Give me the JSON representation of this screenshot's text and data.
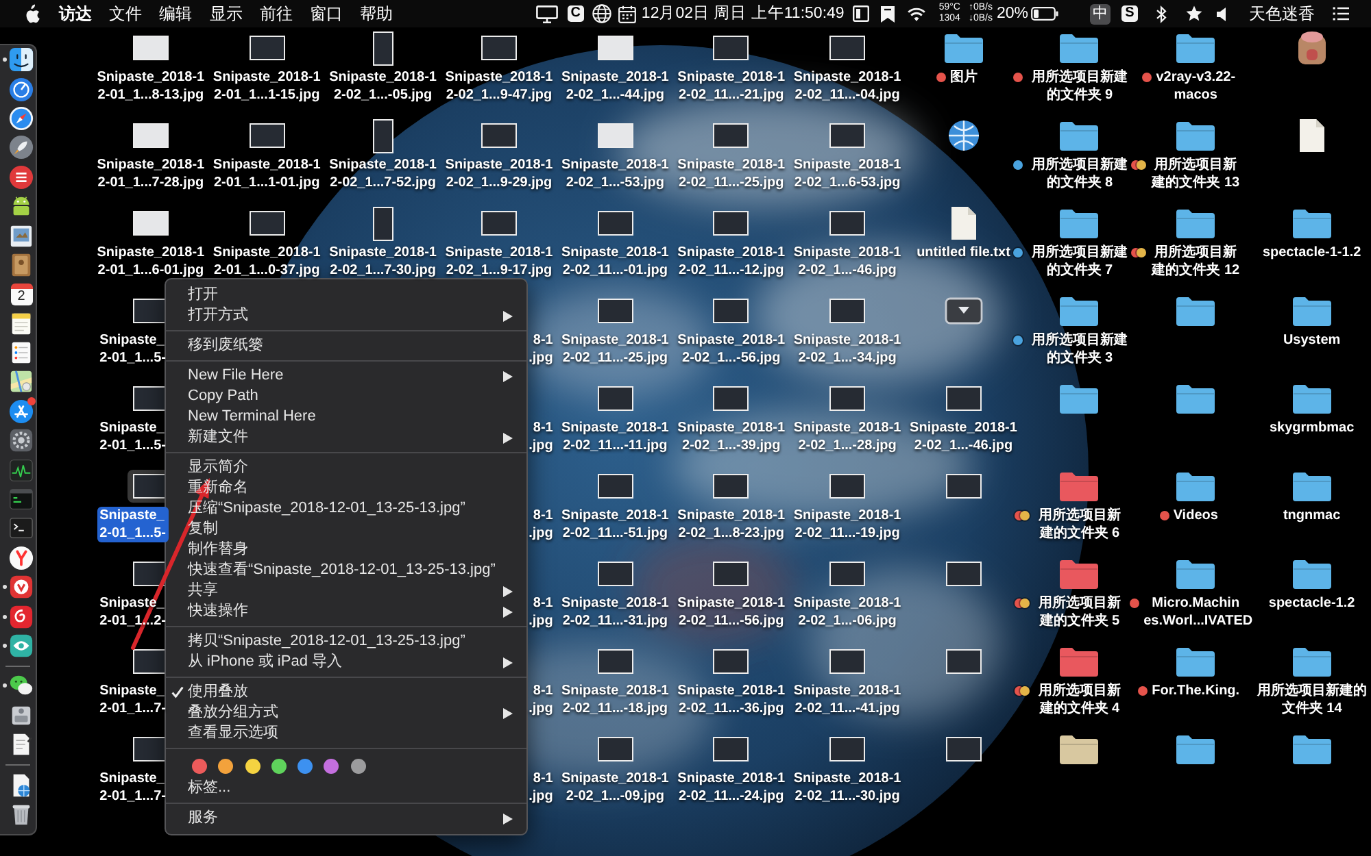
{
  "menu_bar": {
    "app_name": "访达",
    "menus": [
      "文件",
      "编辑",
      "显示",
      "前往",
      "窗口",
      "帮助"
    ],
    "letter_badges": [
      "C",
      "S"
    ],
    "clock": "12月02日 周日 上午11:50:49",
    "sensor": "59°C\n1304",
    "network": "↑0B/s\n↓0B/s",
    "battery": "20%",
    "input_method": "中",
    "user": "天色迷香"
  },
  "dock": {
    "groups": [
      {
        "items": [
          {
            "kind": "face",
            "running": true,
            "badge": false
          },
          {
            "kind": "dial",
            "running": false,
            "badge": false
          },
          {
            "kind": "compass",
            "running": false,
            "badge": false
          },
          {
            "kind": "rocket",
            "running": false,
            "badge": false
          },
          {
            "kind": "stripes",
            "running": false,
            "badge": false
          },
          {
            "kind": "robot",
            "running": false,
            "badge": false
          },
          {
            "kind": "photo",
            "running": false,
            "badge": false
          },
          {
            "kind": "book",
            "running": false,
            "badge": false
          },
          {
            "kind": "calendar",
            "text": "2",
            "running": false,
            "badge": false
          },
          {
            "kind": "notepad",
            "running": false,
            "badge": false
          },
          {
            "kind": "checklist",
            "running": false,
            "badge": false
          },
          {
            "kind": "map",
            "running": false,
            "badge": false
          },
          {
            "kind": "sticks",
            "running": false,
            "badge": true
          },
          {
            "kind": "settings",
            "running": false,
            "badge": false
          },
          {
            "kind": "chart",
            "running": false,
            "badge": false
          },
          {
            "kind": "console",
            "running": false,
            "badge": false
          },
          {
            "kind": "terminal",
            "running": false,
            "badge": false
          },
          {
            "kind": "fork",
            "running": false,
            "badge": false
          },
          {
            "kind": "vlogo",
            "running": true,
            "badge": false
          },
          {
            "kind": "swirl",
            "running": true,
            "badge": false
          },
          {
            "kind": "eye",
            "running": true,
            "badge": false
          }
        ]
      },
      {
        "items": [
          {
            "kind": "chat",
            "running": true,
            "badge": false
          },
          {
            "kind": "disk",
            "running": false,
            "badge": false
          },
          {
            "kind": "paper",
            "running": false,
            "badge": false
          }
        ]
      },
      {
        "items": [
          {
            "kind": "webdoc",
            "running": false,
            "badge": false
          },
          {
            "kind": "trash",
            "running": false,
            "badge": false
          }
        ]
      }
    ]
  },
  "desktop": {
    "columns": [
      {
        "items": [
          {
            "kind": "image",
            "dark": false,
            "portrait": false,
            "label": "Snipaste_2018-1\n2-01_1...8-13.jpg",
            "selected": false
          },
          {
            "kind": "image",
            "dark": false,
            "portrait": false,
            "label": "Snipaste_2018-1\n2-01_1...7-28.jpg",
            "selected": false
          },
          {
            "kind": "image",
            "dark": false,
            "portrait": false,
            "label": "Snipaste_2018-1\n2-01_1...6-01.jpg",
            "selected": false
          },
          {
            "kind": "partial",
            "dark": true,
            "portrait": false,
            "label": "Snipaste_\n2-01_1...5-",
            "selected": false
          },
          {
            "kind": "partial",
            "dark": true,
            "portrait": false,
            "label": "Snipaste_\n2-01_1...5-",
            "selected": false
          },
          {
            "kind": "partial",
            "dark": true,
            "portrait": false,
            "label": "Snipaste_\n2-01_1...5-",
            "selected": true
          },
          {
            "kind": "partial",
            "dark": true,
            "portrait": false,
            "label": "Snipaste_\n2-01_1...2-",
            "selected": false
          },
          {
            "kind": "partial",
            "dark": true,
            "portrait": false,
            "label": "Snipaste_\n2-01_1...7-",
            "selected": false
          },
          {
            "kind": "partial",
            "dark": true,
            "portrait": false,
            "label": "Snipaste_\n2-01_1...7-",
            "selected": false
          }
        ]
      },
      {
        "items": [
          {
            "kind": "image",
            "dark": true,
            "portrait": false,
            "label": "Snipaste_2018-1\n2-01_1...1-15.jpg",
            "selected": false
          },
          {
            "kind": "image",
            "dark": true,
            "portrait": false,
            "label": "Snipaste_2018-1\n2-01_1...1-01.jpg",
            "selected": false
          },
          {
            "kind": "image",
            "dark": true,
            "portrait": false,
            "label": "Snipaste_2018-1\n2-01_1...0-37.jpg",
            "selected": false
          }
        ]
      },
      {
        "items": [
          {
            "kind": "image",
            "dark": true,
            "portrait": true,
            "label": "Snipaste_2018-1\n2-02_1...-05.jpg",
            "selected": false
          },
          {
            "kind": "image",
            "dark": true,
            "portrait": true,
            "label": "Snipaste_2018-1\n2-02_1...7-52.jpg",
            "selected": false
          },
          {
            "kind": "image",
            "dark": true,
            "portrait": true,
            "label": "Snipaste_2018-1\n2-02_1...7-30.jpg",
            "selected": false
          }
        ]
      },
      {
        "items": [
          {
            "kind": "image",
            "dark": true,
            "portrait": false,
            "label": "Snipaste_2018-1\n2-02_1...9-47.jpg",
            "selected": false
          },
          {
            "kind": "image",
            "dark": true,
            "portrait": false,
            "label": "Snipaste_2018-1\n2-02_1...9-29.jpg",
            "selected": false
          },
          {
            "kind": "image",
            "dark": true,
            "portrait": false,
            "label": "Snipaste_2018-1\n2-02_1...9-17.jpg",
            "selected": false
          },
          {
            "kind": "covered",
            "label": "8-1\n.jpg",
            "selected": false
          },
          {
            "kind": "covered",
            "label": "8-1\n.jpg",
            "selected": false
          },
          {
            "kind": "covered",
            "label": "8-1\n.jpg",
            "selected": false
          },
          {
            "kind": "covered",
            "label": "8-1\n.jpg",
            "selected": false
          },
          {
            "kind": "covered",
            "label": "8-1\n.jpg",
            "selected": false
          },
          {
            "kind": "covered",
            "label": "8-1\n.jpg",
            "selected": false
          }
        ]
      },
      {
        "items": [
          {
            "kind": "image",
            "dark": false,
            "portrait": false,
            "label": "Snipaste_2018-1\n2-02_1...-44.jpg",
            "selected": false
          },
          {
            "kind": "image",
            "dark": false,
            "portrait": false,
            "label": "Snipaste_2018-1\n2-02_1...-53.jpg",
            "selected": false
          },
          {
            "kind": "image",
            "dark": true,
            "portrait": false,
            "label": "Snipaste_2018-1\n2-02_11...-01.jpg",
            "selected": false
          },
          {
            "kind": "image",
            "dark": true,
            "portrait": false,
            "label": "Snipaste_2018-1\n2-02_11...-25.jpg",
            "selected": false
          },
          {
            "kind": "image",
            "dark": true,
            "portrait": false,
            "label": "Snipaste_2018-1\n2-02_11...-11.jpg",
            "selected": false
          },
          {
            "kind": "image",
            "dark": true,
            "portrait": false,
            "label": "Snipaste_2018-1\n2-02_11...-51.jpg",
            "selected": false
          },
          {
            "kind": "image",
            "dark": true,
            "portrait": false,
            "label": "Snipaste_2018-1\n2-02_11...-31.jpg",
            "selected": false
          },
          {
            "kind": "image",
            "dark": true,
            "portrait": false,
            "label": "Snipaste_2018-1\n2-02_11...-18.jpg",
            "selected": false
          },
          {
            "kind": "image",
            "dark": true,
            "portrait": false,
            "label": "Snipaste_2018-1\n2-02_1...-09.jpg",
            "selected": false
          }
        ]
      },
      {
        "items": [
          {
            "kind": "image",
            "dark": true,
            "portrait": false,
            "label": "Snipaste_2018-1\n2-02_11...-21.jpg",
            "selected": false
          },
          {
            "kind": "image",
            "dark": true,
            "portrait": false,
            "label": "Snipaste_2018-1\n2-02_11...-25.jpg",
            "selected": false
          },
          {
            "kind": "image",
            "dark": true,
            "portrait": false,
            "label": "Snipaste_2018-1\n2-02_11...-12.jpg",
            "selected": false
          },
          {
            "kind": "image",
            "dark": true,
            "portrait": false,
            "label": "Snipaste_2018-1\n2-02_1...-56.jpg",
            "selected": false
          },
          {
            "kind": "image",
            "dark": true,
            "portrait": false,
            "label": "Snipaste_2018-1\n2-02_1...-39.jpg",
            "selected": false
          },
          {
            "kind": "image",
            "dark": true,
            "portrait": false,
            "label": "Snipaste_2018-1\n2-02_1...8-23.jpg",
            "selected": false
          },
          {
            "kind": "image",
            "dark": true,
            "portrait": false,
            "label": "Snipaste_2018-1\n2-02_11...-56.jpg",
            "selected": false
          },
          {
            "kind": "image",
            "dark": true,
            "portrait": false,
            "label": "Snipaste_2018-1\n2-02_11...-36.jpg",
            "selected": false
          },
          {
            "kind": "image",
            "dark": true,
            "portrait": false,
            "label": "Snipaste_2018-1\n2-02_11...-24.jpg",
            "selected": false
          }
        ]
      },
      {
        "items": [
          {
            "kind": "image",
            "dark": true,
            "portrait": false,
            "label": "Snipaste_2018-1\n2-02_11...-04.jpg",
            "selected": false
          },
          {
            "kind": "image",
            "dark": true,
            "portrait": false,
            "label": "Snipaste_2018-1\n2-02_1...6-53.jpg",
            "selected": false
          },
          {
            "kind": "image",
            "dark": true,
            "portrait": false,
            "label": "Snipaste_2018-1\n2-02_1...-46.jpg",
            "selected": false
          },
          {
            "kind": "image",
            "dark": true,
            "portrait": false,
            "label": "Snipaste_2018-1\n2-02_1...-34.jpg",
            "selected": false
          },
          {
            "kind": "image",
            "dark": true,
            "portrait": false,
            "label": "Snipaste_2018-1\n2-02_1...-28.jpg",
            "selected": false
          },
          {
            "kind": "image",
            "dark": true,
            "portrait": false,
            "label": "Snipaste_2018-1\n2-02_11...-19.jpg",
            "selected": false
          },
          {
            "kind": "image",
            "dark": true,
            "portrait": false,
            "label": "Snipaste_2018-1\n2-02_1...-06.jpg",
            "selected": false
          },
          {
            "kind": "image",
            "dark": true,
            "portrait": false,
            "label": "Snipaste_2018-1\n2-02_11...-41.jpg",
            "selected": false
          },
          {
            "kind": "image",
            "dark": true,
            "portrait": false,
            "label": "Snipaste_2018-1\n2-02_11...-30.jpg",
            "selected": false
          }
        ]
      },
      {
        "items": [
          {
            "kind": "folder",
            "color": "#5db4e8",
            "tags": [
              {
                "color": "#e5534b"
              }
            ],
            "label": "图片",
            "selected": false
          },
          {
            "kind": "globe",
            "selected": false
          },
          {
            "kind": "document",
            "label": "untitled file.txt",
            "selected": false
          },
          {
            "kind": "tray",
            "selected": false
          },
          {
            "kind": "image",
            "dark": true,
            "portrait": false,
            "label": "Snipaste_2018-1\n2-02_1...-46.jpg",
            "selected": false
          },
          {
            "kind": "image",
            "dark": true,
            "portrait": false,
            "selected": false
          },
          {
            "kind": "image",
            "dark": true,
            "portrait": false,
            "selected": false
          },
          {
            "kind": "image",
            "dark": true,
            "portrait": false,
            "selected": false
          },
          {
            "kind": "image",
            "dark": true,
            "portrait": false,
            "selected": false
          }
        ]
      },
      {
        "items": [
          {
            "kind": "folder",
            "color": "#5db4e8",
            "tags": [
              {
                "color": "#e5534b"
              }
            ],
            "label": "用所选项目新建的文件夹 9",
            "selected": false
          },
          {
            "kind": "folder",
            "color": "#5db4e8",
            "tags": [
              {
                "color": "#4aa3df"
              }
            ],
            "label": "用所选项目新建的文件夹 8",
            "selected": false
          },
          {
            "kind": "folder",
            "color": "#5db4e8",
            "tags": [
              {
                "color": "#4aa3df"
              }
            ],
            "label": "用所选项目新建的文件夹 7",
            "selected": false
          },
          {
            "kind": "folder",
            "color": "#5db4e8",
            "tags": [
              {
                "color": "#4aa3df"
              }
            ],
            "label": "用所选项目新建的文件夹 3",
            "selected": false
          },
          {
            "kind": "folder",
            "color": "#5db4e8",
            "selected": false
          },
          {
            "kind": "folder",
            "color": "#e9585e",
            "tags": [
              {
                "color": "#e5534b"
              },
              {
                "color": "#e3b448"
              }
            ],
            "label": "用所选项目新建的文件夹 6",
            "selected": false
          },
          {
            "kind": "folder",
            "color": "#e9585e",
            "tags": [
              {
                "color": "#e5534b"
              },
              {
                "color": "#e3b448"
              }
            ],
            "label": "用所选项目新建的文件夹 5",
            "selected": false
          },
          {
            "kind": "folder",
            "color": "#e9585e",
            "tags": [
              {
                "color": "#e5534b"
              },
              {
                "color": "#e3b448"
              }
            ],
            "label": "用所选项目新建的文件夹 4",
            "selected": false
          },
          {
            "kind": "folder",
            "color": "#d8c8a0",
            "selected": false
          }
        ]
      },
      {
        "items": [
          {
            "kind": "folder",
            "color": "#5db4e8",
            "tags": [
              {
                "color": "#e5534b"
              }
            ],
            "label": "v2ray-v3.22-\nmacos",
            "selected": false
          },
          {
            "kind": "folder",
            "color": "#5db4e8",
            "tags": [
              {
                "color": "#e5534b"
              },
              {
                "color": "#e3b448"
              }
            ],
            "label": "用所选项目新建的文件夹 13",
            "selected": false
          },
          {
            "kind": "folder",
            "color": "#5db4e8",
            "tags": [
              {
                "color": "#e5534b"
              },
              {
                "color": "#e3b448"
              }
            ],
            "label": "用所选项目新建的文件夹 12",
            "selected": false
          },
          {
            "kind": "folder",
            "color": "#5db4e8",
            "selected": false
          },
          {
            "kind": "folder",
            "color": "#5db4e8",
            "selected": false
          },
          {
            "kind": "folder",
            "color": "#5db4e8",
            "tags": [
              {
                "color": "#e5534b"
              }
            ],
            "label": "Videos",
            "selected": false
          },
          {
            "kind": "folder",
            "color": "#5db4e8",
            "tags": [
              {
                "color": "#e5534b"
              }
            ],
            "label": "Micro.Machin\nes.Worl...IVATED",
            "selected": false
          },
          {
            "kind": "folder",
            "color": "#5db4e8",
            "tags": [
              {
                "color": "#e5534b"
              }
            ],
            "label": "For.The.King.",
            "selected": false
          },
          {
            "kind": "folder",
            "color": "#5db4e8",
            "selected": false
          }
        ]
      },
      {
        "items": [
          {
            "kind": "pot",
            "selected": false
          },
          {
            "kind": "document",
            "selected": false
          },
          {
            "kind": "folder",
            "color": "#5db4e8",
            "label": "spectacle-1-1.2",
            "selected": false
          },
          {
            "kind": "folder",
            "color": "#5db4e8",
            "label": "Usystem",
            "selected": false
          },
          {
            "kind": "folder",
            "color": "#5db4e8",
            "label": "skygrmbmac",
            "selected": false
          },
          {
            "kind": "folder",
            "color": "#5db4e8",
            "label": "tngnmac",
            "selected": false
          },
          {
            "kind": "folder",
            "color": "#5db4e8",
            "label": "spectacle-1.2",
            "selected": false
          },
          {
            "kind": "folder",
            "color": "#5db4e8",
            "label": "用所选项目新建的文件夹 14",
            "selected": false
          },
          {
            "kind": "folder",
            "color": "#5db4e8",
            "selected": false
          }
        ]
      }
    ]
  },
  "context_menu": {
    "groups": [
      {
        "items": [
          {
            "label": "打开",
            "submenu": false,
            "checked": false
          },
          {
            "label": "打开方式",
            "submenu": true,
            "checked": false
          }
        ]
      },
      {
        "items": [
          {
            "label": "移到废纸篓",
            "submenu": false,
            "checked": false
          }
        ]
      },
      {
        "items": [
          {
            "label": "New File Here",
            "submenu": true,
            "checked": false
          },
          {
            "label": "Copy Path",
            "submenu": false,
            "checked": false
          },
          {
            "label": "New Terminal Here",
            "submenu": false,
            "checked": false
          },
          {
            "label": "新建文件",
            "submenu": true,
            "checked": false
          }
        ]
      },
      {
        "items": [
          {
            "label": "显示简介",
            "submenu": false,
            "checked": false
          },
          {
            "label": "重新命名",
            "submenu": false,
            "checked": false
          },
          {
            "label": "压缩“Snipaste_2018-12-01_13-25-13.jpg”",
            "submenu": false,
            "checked": false
          },
          {
            "label": "复制",
            "submenu": false,
            "checked": false
          },
          {
            "label": "制作替身",
            "submenu": false,
            "checked": false
          },
          {
            "label": "快速查看“Snipaste_2018-12-01_13-25-13.jpg”",
            "submenu": false,
            "checked": false
          },
          {
            "label": "共享",
            "submenu": true,
            "checked": false
          },
          {
            "label": "快速操作",
            "submenu": true,
            "checked": false
          }
        ]
      },
      {
        "items": [
          {
            "label": "拷贝“Snipaste_2018-12-01_13-25-13.jpg”",
            "submenu": false,
            "checked": false
          },
          {
            "label": "从 iPhone 或 iPad 导入",
            "submenu": true,
            "checked": false
          }
        ]
      },
      {
        "items": [
          {
            "label": "使用叠放",
            "submenu": false,
            "checked": true
          },
          {
            "label": "叠放分组方式",
            "submenu": true,
            "checked": false
          },
          {
            "label": "查看显示选项",
            "submenu": false,
            "checked": false
          }
        ]
      },
      {
        "tag_colors": [
          {
            "color": "#ec5b5b"
          },
          {
            "color": "#f3a23c"
          },
          {
            "color": "#f5d341"
          },
          {
            "color": "#5fd35c"
          },
          {
            "color": "#3d91f0"
          },
          {
            "color": "#c46fdf"
          },
          {
            "color": "#9c9c9e"
          }
        ],
        "items": [
          {
            "label": "标签...",
            "submenu": false,
            "checked": false
          }
        ]
      },
      {
        "items": [
          {
            "label": "服务",
            "submenu": true,
            "checked": false
          }
        ]
      }
    ]
  }
}
